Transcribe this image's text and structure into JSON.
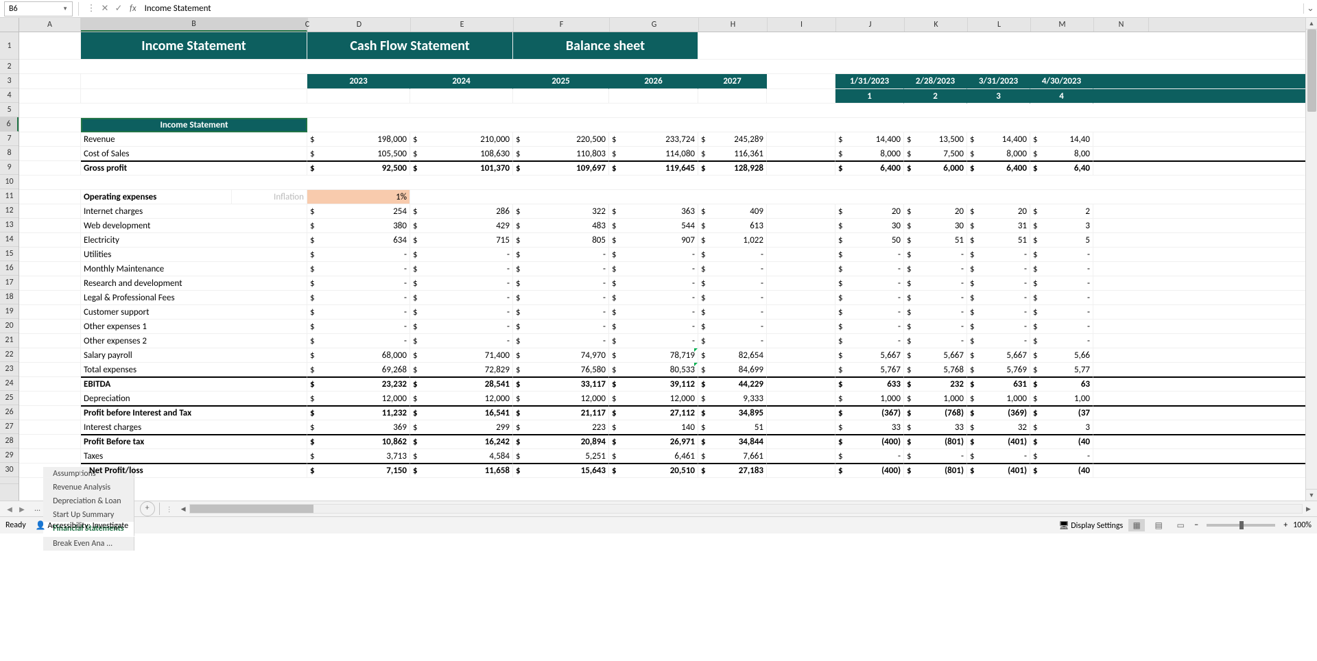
{
  "nameBox": "B6",
  "formulaContent": "Income Statement",
  "columns": [
    "A",
    "B",
    "C",
    "D",
    "E",
    "F",
    "G",
    "H",
    "I",
    "J",
    "K",
    "L",
    "M"
  ],
  "bigTabs": [
    "Income Statement",
    "Cash Flow Statement",
    "Balance sheet"
  ],
  "years": [
    "2023",
    "2024",
    "2025",
    "2026",
    "2027"
  ],
  "monthHdr": [
    "1/31/2023",
    "2/28/2023",
    "3/31/2023",
    "4/30/2023"
  ],
  "monthNum": [
    "1",
    "2",
    "3",
    "4"
  ],
  "sectionHdr": "Income Statement",
  "labels": {
    "revenue": "Revenue",
    "cos": "Cost of Sales",
    "gp": "Gross profit",
    "opex": "Operating expenses",
    "inflation": "Inflation",
    "internet": "Internet charges",
    "webdev": "Web development",
    "elec": "Electricity",
    "util": "Utilities",
    "maint": "Monthly Maintenance",
    "rnd": "Research and development",
    "legal": "Legal & Professional Fees",
    "cust": "Customer support",
    "oth1": "Other expenses 1",
    "oth2": "Other expenses 2",
    "salary": "Salary payroll",
    "totex": "Total expenses",
    "ebitda": "EBITDA",
    "dep": "Depreciation",
    "pbit": "Profit before Interest and Tax",
    "int": "Interest charges",
    "pbt": "Profit Before tax",
    "tax": "Taxes",
    "np": "Net Profit/loss"
  },
  "inflationVal": "1%",
  "annual": {
    "revenue": [
      "198,000",
      "210,000",
      "220,500",
      "233,724",
      "245,289"
    ],
    "cos": [
      "105,500",
      "108,630",
      "110,803",
      "114,080",
      "116,361"
    ],
    "gp": [
      "92,500",
      "101,370",
      "109,697",
      "119,645",
      "128,928"
    ],
    "internet": [
      "254",
      "286",
      "322",
      "363",
      "409"
    ],
    "webdev": [
      "380",
      "429",
      "483",
      "544",
      "613"
    ],
    "elec": [
      "634",
      "715",
      "805",
      "907",
      "1,022"
    ],
    "util": [
      "-",
      "-",
      "-",
      "-",
      "-"
    ],
    "maint": [
      "-",
      "-",
      "-",
      "-",
      "-"
    ],
    "rnd": [
      "-",
      "-",
      "-",
      "-",
      "-"
    ],
    "legal": [
      "-",
      "-",
      "-",
      "-",
      "-"
    ],
    "cust": [
      "-",
      "-",
      "-",
      "-",
      "-"
    ],
    "oth1": [
      "-",
      "-",
      "-",
      "-",
      "-"
    ],
    "oth2": [
      "-",
      "-",
      "-",
      "-",
      "-"
    ],
    "salary": [
      "68,000",
      "71,400",
      "74,970",
      "78,719",
      "82,654"
    ],
    "totex": [
      "69,268",
      "72,829",
      "76,580",
      "80,533",
      "84,699"
    ],
    "ebitda": [
      "23,232",
      "28,541",
      "33,117",
      "39,112",
      "44,229"
    ],
    "dep": [
      "12,000",
      "12,000",
      "12,000",
      "12,000",
      "9,333"
    ],
    "pbit": [
      "11,232",
      "16,541",
      "21,117",
      "27,112",
      "34,895"
    ],
    "int": [
      "369",
      "299",
      "223",
      "140",
      "51"
    ],
    "pbt": [
      "10,862",
      "16,242",
      "20,894",
      "26,971",
      "34,844"
    ],
    "tax": [
      "3,713",
      "4,584",
      "5,251",
      "6,461",
      "7,661"
    ],
    "np": [
      "7,150",
      "11,658",
      "15,643",
      "20,510",
      "27,183"
    ]
  },
  "monthly": {
    "revenue": [
      "14,400",
      "13,500",
      "14,400",
      "14,40"
    ],
    "cos": [
      "8,000",
      "7,500",
      "8,000",
      "8,00"
    ],
    "gp": [
      "6,400",
      "6,000",
      "6,400",
      "6,40"
    ],
    "internet": [
      "20",
      "20",
      "20",
      "2"
    ],
    "webdev": [
      "30",
      "30",
      "31",
      "3"
    ],
    "elec": [
      "50",
      "51",
      "51",
      "5"
    ],
    "util": [
      "-",
      "-",
      "-",
      "-"
    ],
    "maint": [
      "-",
      "-",
      "-",
      "-"
    ],
    "rnd": [
      "-",
      "-",
      "-",
      "-"
    ],
    "legal": [
      "-",
      "-",
      "-",
      "-"
    ],
    "cust": [
      "-",
      "-",
      "-",
      "-"
    ],
    "oth1": [
      "-",
      "-",
      "-",
      "-"
    ],
    "oth2": [
      "-",
      "-",
      "-",
      "-"
    ],
    "salary": [
      "5,667",
      "5,667",
      "5,667",
      "5,66"
    ],
    "totex": [
      "5,767",
      "5,768",
      "5,769",
      "5,77"
    ],
    "ebitda": [
      "633",
      "232",
      "631",
      "63"
    ],
    "dep": [
      "1,000",
      "1,000",
      "1,000",
      "1,00"
    ],
    "pbit": [
      "(367)",
      "(768)",
      "(369)",
      "(37"
    ],
    "int": [
      "33",
      "33",
      "32",
      "3"
    ],
    "pbt": [
      "(400)",
      "(801)",
      "(401)",
      "(40"
    ],
    "tax": [
      "-",
      "-",
      "-",
      "-"
    ],
    "np": [
      "(400)",
      "(801)",
      "(401)",
      "(40"
    ]
  },
  "tabs": [
    "Assumptions",
    "Revenue Analysis",
    "Depreciation & Loan",
    "Start Up Summary",
    "Financial Statements",
    "Break Even Ana ..."
  ],
  "activeTab": 4,
  "status": {
    "ready": "Ready",
    "acc": "Accessibility: Investigate",
    "disp": "Display Settings",
    "zoom": "100%"
  }
}
